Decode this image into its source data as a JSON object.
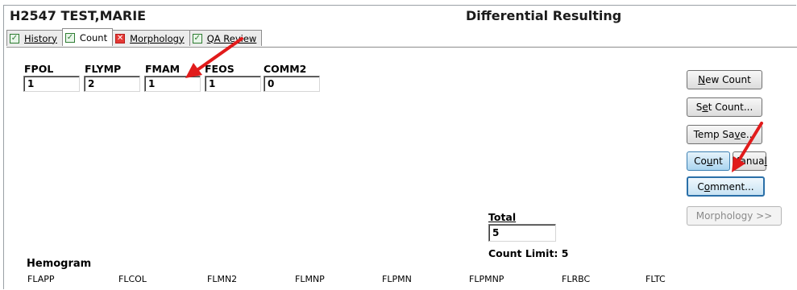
{
  "header": {
    "patient": "H2547 TEST,MARIE",
    "module_title": "Differential Resulting"
  },
  "tabs": [
    {
      "label": "History",
      "status": "complete",
      "status_color": "#2e7d32"
    },
    {
      "label": "Count",
      "status": "complete",
      "status_color": "#2e7d32",
      "active": true
    },
    {
      "label": "Morphology",
      "status": "error",
      "status_color": "#e53935"
    },
    {
      "label": "QA Review",
      "status": "complete",
      "status_color": "#2e7d32"
    }
  ],
  "count_fields": [
    {
      "label": "FPOL",
      "value": "1"
    },
    {
      "label": "FLYMP",
      "value": "2"
    },
    {
      "label": "FMAM",
      "value": "1"
    },
    {
      "label": "FEOS",
      "value": "1"
    },
    {
      "label": "COMM2",
      "value": "0"
    }
  ],
  "buttons": {
    "new_count": {
      "pre": "",
      "mn": "N",
      "post": "ew Count"
    },
    "set_count": {
      "pre": "S",
      "mn": "e",
      "post": "t Count..."
    },
    "temp_save": {
      "pre": "Temp Sa",
      "mn": "v",
      "post": "e..."
    },
    "count": {
      "pre": "Co",
      "mn": "u",
      "post": "nt"
    },
    "manual": {
      "pre": "Manua",
      "mn": "l",
      "post": ""
    },
    "comment": {
      "pre": "C",
      "mn": "o",
      "post": "mment..."
    },
    "morphology": {
      "label": "Morphology >>"
    }
  },
  "totals": {
    "total_label": "Total",
    "total_value": "5",
    "count_limit": "Count Limit: 5"
  },
  "hemogram": {
    "title": "Hemogram",
    "columns": [
      "FLAPP",
      "FLCOL",
      "FLMN2",
      "FLMNP",
      "FLPMN",
      "FLPMNP",
      "FLRBC",
      "FLTC"
    ]
  },
  "annotation_color": "#e11b1b"
}
